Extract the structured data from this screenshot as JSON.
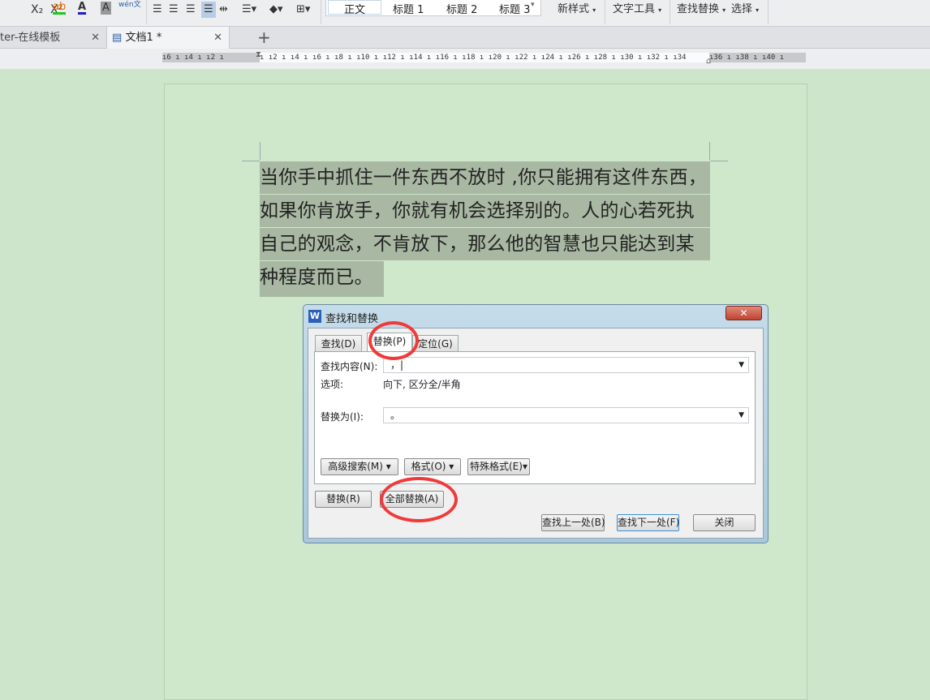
{
  "toolbar": {
    "style_normal": "正文",
    "style_h1": "标题 1",
    "style_h2": "标题 2",
    "style_h3": "标题 3",
    "new_style": "新样式",
    "text_tools": "文字工具",
    "find_replace": "查找替换",
    "select": "选择",
    "superscript": "X²",
    "subscript": "X₂",
    "pinyin": "wén文"
  },
  "tabs": [
    {
      "label": "ter-在线模板"
    },
    {
      "label": "文档1 *"
    }
  ],
  "ruler": {
    "left": "ı6 ı ı4 ı ı2 ı",
    "right": "ı ı2 ı ı4 ı ı6 ı ı8 ı ı10 ı ı12 ı ı14 ı ı16 ı ı18 ı ı20 ı ı22 ı ı24 ı ı26 ı ı28 ı ı30 ı ı32 ı ı34",
    "far": "ı36 ı ı38 ı ı40 ı"
  },
  "document": {
    "lines": [
      "当你手中抓住一件东西不放时 ,你只能拥有这件东西，",
      "如果你肯放手，你就有机会选择别的。人的心若死执",
      "自己的观念，不肯放下，那么他的智慧也只能达到某",
      "种程度而已。"
    ]
  },
  "dialog": {
    "title": "查找和替换",
    "tabs": [
      "查找(D)",
      "替换(P)",
      "定位(G)"
    ],
    "find_label": "查找内容(N):",
    "find_value": "，|",
    "options_label": "选项:",
    "options_value": "向下, 区分全/半角",
    "replace_label": "替换为(I):",
    "replace_value": "。",
    "advanced": "高级搜索(M) ▾",
    "format": "格式(O)",
    "special": "特殊格式(E)",
    "replace_btn": "替换(R)",
    "replace_all": "全部替换(A)",
    "find_prev": "查找上一处(B)",
    "find_next": "查找下一处(F)",
    "close": "关闭"
  },
  "colors": {
    "highlight": "#a9b8a3",
    "annotation": "#f03a3a",
    "page": "#cfe8cc"
  }
}
